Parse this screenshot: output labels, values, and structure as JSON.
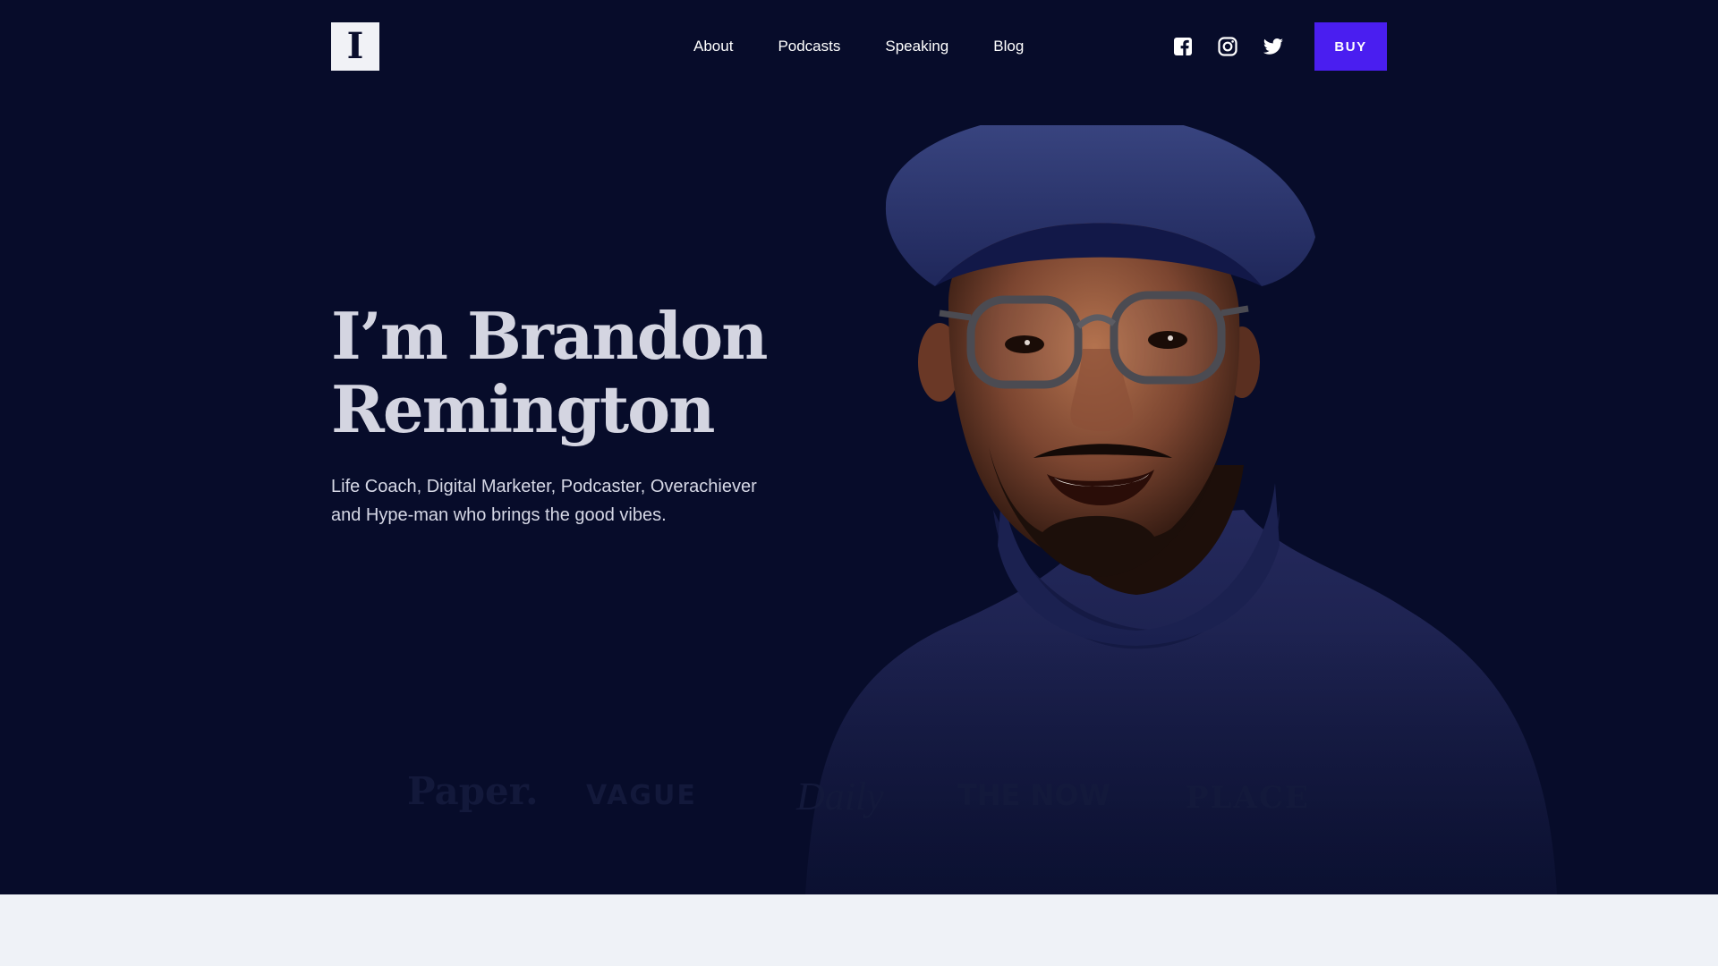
{
  "logo": {
    "letter": "I"
  },
  "nav": {
    "items": [
      {
        "label": "About"
      },
      {
        "label": "Podcasts"
      },
      {
        "label": "Speaking"
      },
      {
        "label": "Blog"
      }
    ]
  },
  "social": {
    "icons": [
      "facebook-icon",
      "instagram-icon",
      "twitter-icon"
    ]
  },
  "buy_button": {
    "label": "BUY"
  },
  "hero": {
    "headline_line1": "I’m Brandon",
    "headline_line2": "Remington",
    "subtitle": "Life Coach, Digital Marketer, Podcaster, Overachiever and Hype-man who brings the good vibes."
  },
  "press": {
    "logos": [
      {
        "name": "Paper."
      },
      {
        "name": "VAGUE"
      },
      {
        "name": "Daily"
      },
      {
        "name": "THE NOW"
      },
      {
        "name": "PLACE"
      }
    ]
  },
  "colors": {
    "hero_background": "#070c2a",
    "accent": "#4a1ef0",
    "lower_background": "#eff2f7"
  }
}
